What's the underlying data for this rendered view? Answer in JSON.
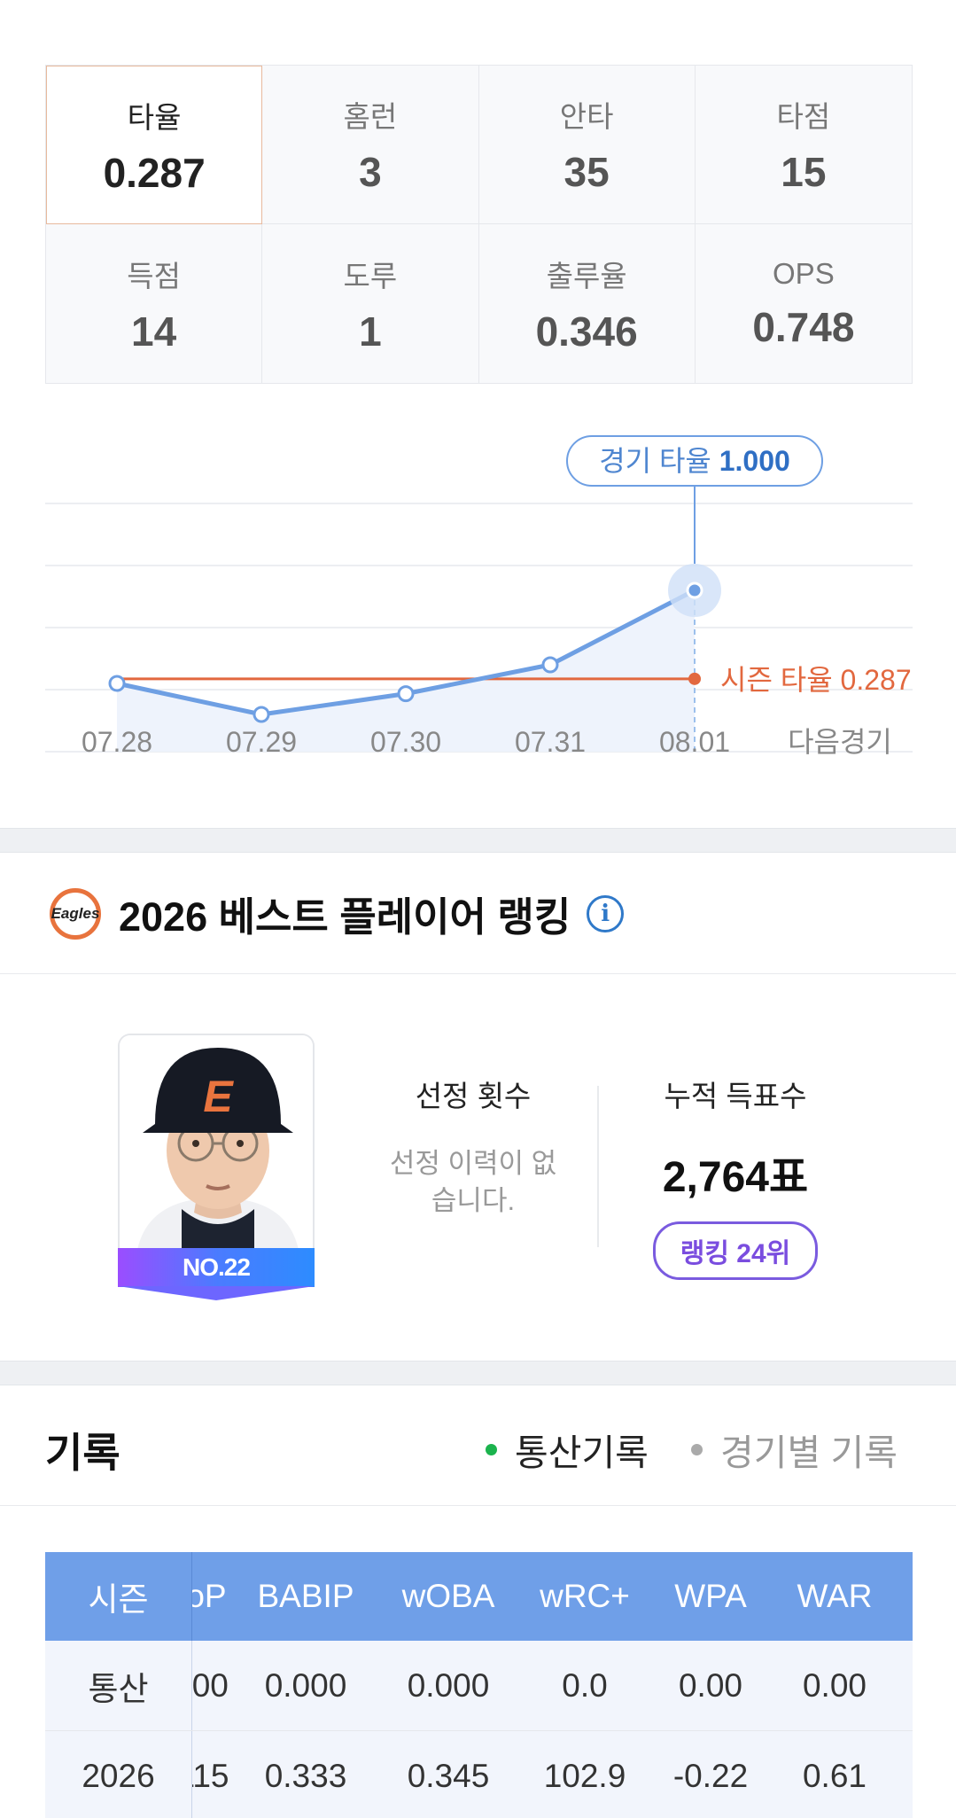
{
  "stats": [
    {
      "label": "타율",
      "value": "0.287"
    },
    {
      "label": "홈런",
      "value": "3"
    },
    {
      "label": "안타",
      "value": "35"
    },
    {
      "label": "타점",
      "value": "15"
    },
    {
      "label": "득점",
      "value": "14"
    },
    {
      "label": "도루",
      "value": "1"
    },
    {
      "label": "출루율",
      "value": "0.346"
    },
    {
      "label": "OPS",
      "value": "0.748"
    }
  ],
  "chart_data": {
    "type": "line",
    "categories": [
      "07.28",
      "07.29",
      "07.30",
      "07.31",
      "08.01",
      "다음경기"
    ],
    "series": [
      {
        "values": [
          0.25,
          0.0,
          0.167,
          0.4,
          1.0
        ]
      }
    ],
    "reference_line": {
      "label": "시즌 타율",
      "value": 0.287
    },
    "tooltip": {
      "label": "경기 타율",
      "value": "1.000"
    },
    "ylim": [
      -0.3,
      1.7
    ],
    "colors": {
      "series": "#6e9fe3",
      "season": "#e2683f",
      "fill": "#eef3fc"
    }
  },
  "ranking": {
    "title": "2026 베스트 플레이어 랭킹",
    "team_logo_text": "Eagles",
    "info_icon": "i",
    "player_number": "NO.22",
    "selection_title": "선정 횟수",
    "selection_empty": "선정 이력이 없습니다.",
    "votes_title": "누적 득표수",
    "votes_value": "2,764표",
    "rank_badge": "랭킹 24위"
  },
  "records": {
    "title": "기록",
    "tab_total": "통산기록",
    "tab_game": "경기별 기록",
    "columns": [
      "시즌",
      "oP",
      "BABIP",
      "wOBA",
      "wRC+",
      "WPA",
      "WAR"
    ],
    "rows": [
      [
        "통산",
        "000",
        "0.000",
        "0.000",
        "0.0",
        "0.00",
        "0.00"
      ],
      [
        "2026",
        "115",
        "0.333",
        "0.345",
        "102.9",
        "-0.22",
        "0.61"
      ]
    ]
  }
}
